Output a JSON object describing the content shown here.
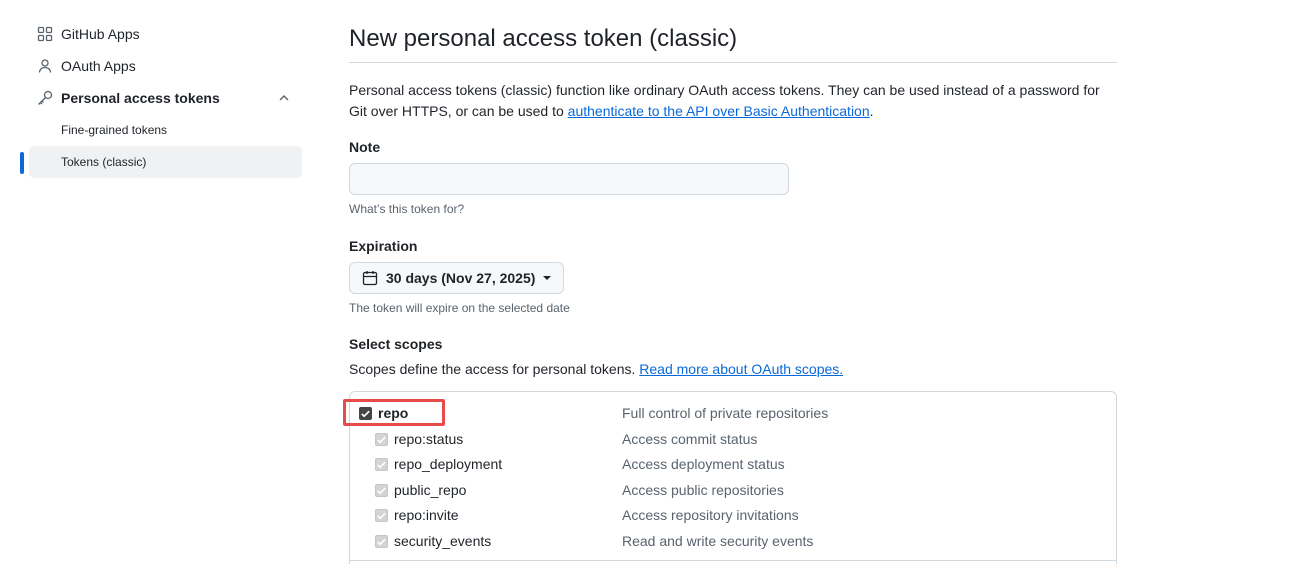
{
  "sidebar": {
    "items": [
      {
        "label": "GitHub Apps",
        "icon": "apps-grid-icon"
      },
      {
        "label": "OAuth Apps",
        "icon": "person-icon"
      },
      {
        "label": "Personal access tokens",
        "icon": "key-icon"
      }
    ],
    "subitems": [
      {
        "label": "Fine-grained tokens"
      },
      {
        "label": "Tokens (classic)",
        "active": true
      }
    ]
  },
  "main": {
    "title": "New personal access token (classic)",
    "intro_text": "Personal access tokens (classic) function like ordinary OAuth access tokens. They can be used instead of a password for Git over HTTPS, or can be used to ",
    "intro_link": "authenticate to the API over Basic Authentication",
    "intro_end": ".",
    "note": {
      "label": "Note",
      "value": "",
      "hint": "What’s this token for?"
    },
    "expiration": {
      "label": "Expiration",
      "selected": "30 days (Nov 27, 2025)",
      "hint": "The token will expire on the selected date"
    },
    "scopes": {
      "label": "Select scopes",
      "desc_text": "Scopes define the access for personal tokens. ",
      "desc_link": "Read more about OAuth scopes.",
      "items": [
        {
          "name": "repo",
          "desc": "Full control of private repositories",
          "checked": true
        },
        {
          "name": "repo:status",
          "desc": "Access commit status",
          "checked": true
        },
        {
          "name": "repo_deployment",
          "desc": "Access deployment status",
          "checked": true
        },
        {
          "name": "public_repo",
          "desc": "Access public repositories",
          "checked": true
        },
        {
          "name": "repo:invite",
          "desc": "Access repository invitations",
          "checked": true
        },
        {
          "name": "security_events",
          "desc": "Read and write security events",
          "checked": true
        }
      ]
    }
  },
  "colors": {
    "accent": "#0969da",
    "highlight": "#e84c4a",
    "muted": "#59636e"
  }
}
